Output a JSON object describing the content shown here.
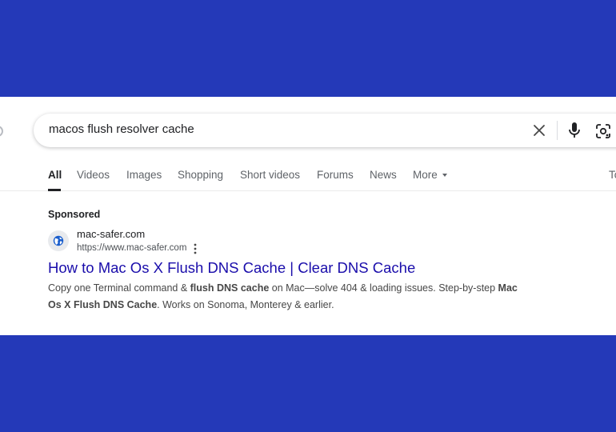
{
  "colors": {
    "background": "#2439b8",
    "link": "#1a0dab",
    "text": "#202124",
    "muted": "#5f6368"
  },
  "search": {
    "query": "macos flush resolver cache"
  },
  "tabs": [
    {
      "label": "All",
      "active": true
    },
    {
      "label": "Videos"
    },
    {
      "label": "Images"
    },
    {
      "label": "Shopping"
    },
    {
      "label": "Short videos"
    },
    {
      "label": "Forums"
    },
    {
      "label": "News"
    },
    {
      "label": "More"
    },
    {
      "label": "To"
    }
  ],
  "ad": {
    "sponsored_label": "Sponsored",
    "site_name": "mac-safer.com",
    "site_url": "https://www.mac-safer.com",
    "title": "How to Mac Os X Flush DNS Cache | Clear DNS Cache",
    "desc": {
      "p1": "Copy one Terminal command & ",
      "b1": "flush DNS cache",
      "p2": " on Mac—solve 404 & loading issues. Step-by-step ",
      "b2": "Mac Os X Flush DNS Cache",
      "p3": ". Works on Sonoma, Monterey & earlier."
    }
  },
  "icons": [
    "globe-icon",
    "clear-icon",
    "microphone-icon",
    "lens-icon",
    "more-options-icon",
    "caret-down-icon"
  ]
}
